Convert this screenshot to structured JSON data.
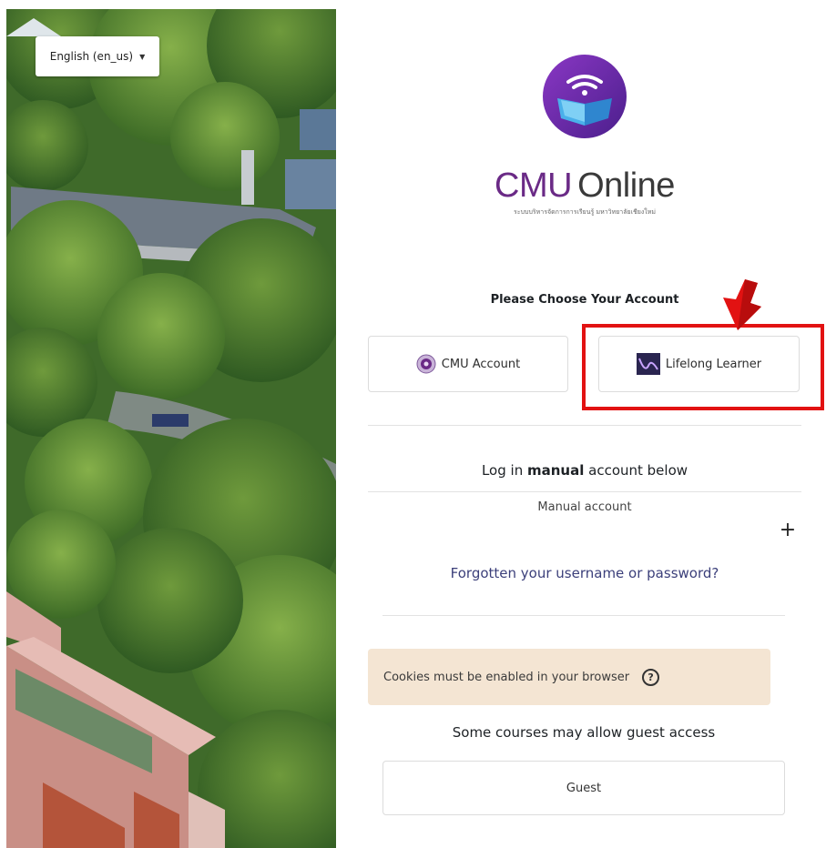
{
  "language_selector": {
    "value": "English (en_us)",
    "caret": "▼"
  },
  "brand": {
    "name_part1": "CMU",
    "name_part2": "Online",
    "subtitle": "ระบบบริหารจัดการการเรียนรู้ มหาวิทยาลัยเชียงใหม่",
    "logo_icon": "book-wifi-icon"
  },
  "login": {
    "choose_title": "Please Choose Your Account",
    "accounts": [
      {
        "label": "CMU Account",
        "icon": "cmu-seal-icon"
      },
      {
        "label": "Lifelong Learner",
        "icon": "lifelong-learner-icon"
      }
    ],
    "manual_prefix": "Log in ",
    "manual_bold": "manual",
    "manual_suffix": " account below",
    "manual_account_label": "Manual account",
    "expand_symbol": "+",
    "forgot_link": "Forgotten your username or password?",
    "cookie_notice": "Cookies must be enabled in your browser",
    "help_symbol": "?",
    "guest_note": "Some courses may allow guest access",
    "guest_button": "Guest"
  },
  "colors": {
    "highlight": "#e21212",
    "brand_purple": "#6a2a86",
    "link": "#3b3f7a",
    "cookie_bg": "#f4e5d3"
  }
}
